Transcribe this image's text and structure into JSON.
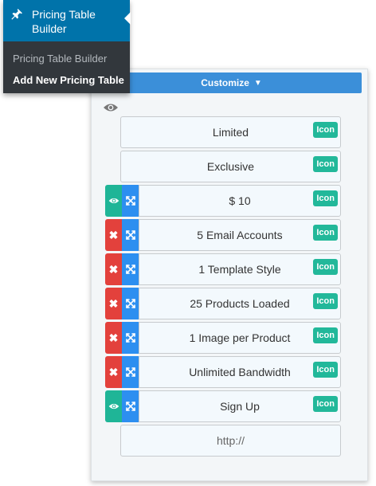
{
  "admin_menu": {
    "title": "Pricing Table Builder",
    "submenu": [
      "Pricing Table Builder",
      "Add New Pricing Table"
    ],
    "icon": "pushpin-icon"
  },
  "builder": {
    "customize_label": "Customize",
    "caret": "▼",
    "icon_button_label": "Icon",
    "rows": [
      {
        "text": "Limited",
        "action": null,
        "movable": false,
        "icon_button": true
      },
      {
        "text": "Exclusive",
        "action": null,
        "movable": false,
        "icon_button": true
      },
      {
        "text": "$ 10",
        "action": "show",
        "movable": true,
        "icon_button": true
      },
      {
        "text": "5 Email Accounts",
        "action": "remove",
        "movable": true,
        "icon_button": true
      },
      {
        "text": "1 Template Style",
        "action": "remove",
        "movable": true,
        "icon_button": true
      },
      {
        "text": "25 Products Loaded",
        "action": "remove",
        "movable": true,
        "icon_button": true
      },
      {
        "text": "1 Image per Product",
        "action": "remove",
        "movable": true,
        "icon_button": true
      },
      {
        "text": "Unlimited Bandwidth",
        "action": "remove",
        "movable": true,
        "icon_button": true
      },
      {
        "text": "Sign Up",
        "action": "show",
        "movable": true,
        "icon_button": true
      },
      {
        "placeholder": "http://",
        "action": null,
        "movable": false,
        "icon_button": false
      }
    ]
  },
  "colors": {
    "wp_blue": "#0073aa",
    "wp_dark": "#32373c",
    "customize_blue": "#3b8fd9",
    "teal": "#1fb597",
    "red": "#e3413c",
    "move_blue": "#2d8ff0"
  }
}
